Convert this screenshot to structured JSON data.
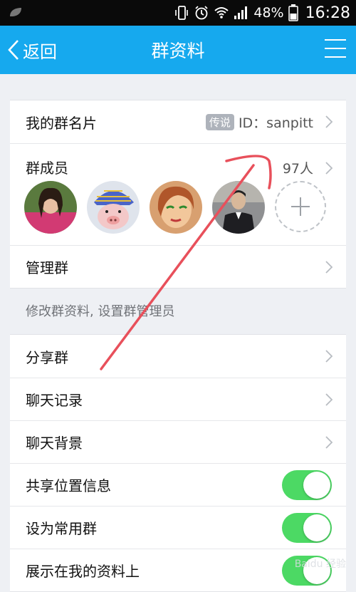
{
  "status_bar": {
    "battery": "48%",
    "time": "16:28"
  },
  "navbar": {
    "back_label": "返回",
    "title": "群资料"
  },
  "card": {
    "label": "我的群名片",
    "tag": "传说",
    "value": "ID：sanpitt"
  },
  "members": {
    "label": "群成员",
    "count": "97人"
  },
  "manage": {
    "label": "管理群",
    "hint": "修改群资料, 设置群管理员"
  },
  "settings": [
    {
      "label": "分享群"
    },
    {
      "label": "聊天记录"
    },
    {
      "label": "聊天背景"
    },
    {
      "label": "共享位置信息",
      "toggle": true
    },
    {
      "label": "设为常用群",
      "toggle": true
    },
    {
      "label": "展示在我的资料上",
      "toggle": true
    }
  ],
  "colors": {
    "accent": "#16a9ee",
    "toggle_on": "#4cd964",
    "annotation": "#e8505b"
  },
  "watermark": "Baidu 经验"
}
